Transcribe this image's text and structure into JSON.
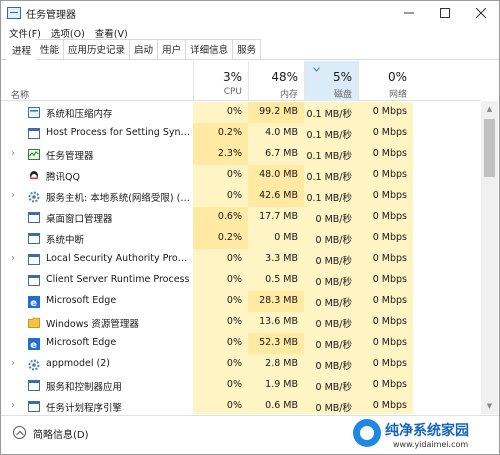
{
  "window": {
    "title": "任务管理器"
  },
  "menu": [
    "文件(F)",
    "选项(O)",
    "查看(V)"
  ],
  "tabs": [
    "进程",
    "性能",
    "应用历史记录",
    "启动",
    "用户",
    "详细信息",
    "服务"
  ],
  "columns": {
    "name": "名称",
    "cpu": {
      "pct": "3%",
      "label": "CPU"
    },
    "mem": {
      "pct": "48%",
      "label": "内存"
    },
    "disk": {
      "pct": "5%",
      "label": "磁盘"
    },
    "net": {
      "pct": "0%",
      "label": "网络"
    }
  },
  "rows": [
    {
      "name": "系统和压缩内存",
      "cpu": "0%",
      "mem": "99.2 MB",
      "disk": "0.1 MB/秒",
      "net": "0 Mbps",
      "icon": "system-icon",
      "expandable": false
    },
    {
      "name": "Host Process for Setting Synch...",
      "cpu": "0.2%",
      "mem": "4.0 MB",
      "disk": "0.1 MB/秒",
      "net": "0 Mbps",
      "icon": "window-icon",
      "expandable": false
    },
    {
      "name": "任务管理器",
      "cpu": "2.3%",
      "mem": "6.7 MB",
      "disk": "0.1 MB/秒",
      "net": "0 Mbps",
      "icon": "taskmgr-icon",
      "expandable": true
    },
    {
      "name": "腾讯QQ",
      "cpu": "0%",
      "mem": "48.0 MB",
      "disk": "0.1 MB/秒",
      "net": "0 Mbps",
      "icon": "qq-icon",
      "expandable": false
    },
    {
      "name": "服务主机: 本地系统(网络受限) (9)",
      "cpu": "0%",
      "mem": "42.6 MB",
      "disk": "0.1 MB/秒",
      "net": "0 Mbps",
      "icon": "gear-icon",
      "expandable": true
    },
    {
      "name": "桌面窗口管理器",
      "cpu": "0.6%",
      "mem": "17.7 MB",
      "disk": "0 MB/秒",
      "net": "0 Mbps",
      "icon": "window-icon",
      "expandable": false
    },
    {
      "name": "系统中断",
      "cpu": "0.2%",
      "mem": "0 MB",
      "disk": "0 MB/秒",
      "net": "0 Mbps",
      "icon": "window-icon",
      "expandable": false
    },
    {
      "name": "Local Security Authority Proces...",
      "cpu": "0%",
      "mem": "3.3 MB",
      "disk": "0 MB/秒",
      "net": "0 Mbps",
      "icon": "window-icon",
      "expandable": true
    },
    {
      "name": "Client Server Runtime Process",
      "cpu": "0%",
      "mem": "0.5 MB",
      "disk": "0 MB/秒",
      "net": "0 Mbps",
      "icon": "window-icon",
      "expandable": false
    },
    {
      "name": "Microsoft Edge",
      "cpu": "0%",
      "mem": "28.3 MB",
      "disk": "0 MB/秒",
      "net": "0 Mbps",
      "icon": "edge-icon",
      "expandable": false
    },
    {
      "name": "Windows 资源管理器",
      "cpu": "0%",
      "mem": "13.6 MB",
      "disk": "0 MB/秒",
      "net": "0 Mbps",
      "icon": "folder-icon",
      "expandable": false
    },
    {
      "name": "Microsoft Edge",
      "cpu": "0%",
      "mem": "52.3 MB",
      "disk": "0 MB/秒",
      "net": "0 Mbps",
      "icon": "edge-icon",
      "expandable": false
    },
    {
      "name": "appmodel (2)",
      "cpu": "0%",
      "mem": "2.8 MB",
      "disk": "0 MB/秒",
      "net": "0 Mbps",
      "icon": "gear-icon",
      "expandable": true
    },
    {
      "name": "服务和控制器应用",
      "cpu": "0%",
      "mem": "1.9 MB",
      "disk": "0 MB/秒",
      "net": "0 Mbps",
      "icon": "window-icon",
      "expandable": false
    },
    {
      "name": "任务计划程序引擎",
      "cpu": "0%",
      "mem": "0.6 MB",
      "disk": "0 MB/秒",
      "net": "0 Mbps",
      "icon": "window-icon",
      "expandable": true
    }
  ],
  "footer": {
    "label": "简略信息(D)"
  },
  "watermark": {
    "title": "纯净系统家园",
    "url": "www.yidaimei.com"
  },
  "colors": {
    "heat_light": "#fff4c4",
    "heat_mid": "#ffe9a3",
    "sorted_header": "#dcebf8",
    "edge_blue": "#1f6fd0"
  }
}
